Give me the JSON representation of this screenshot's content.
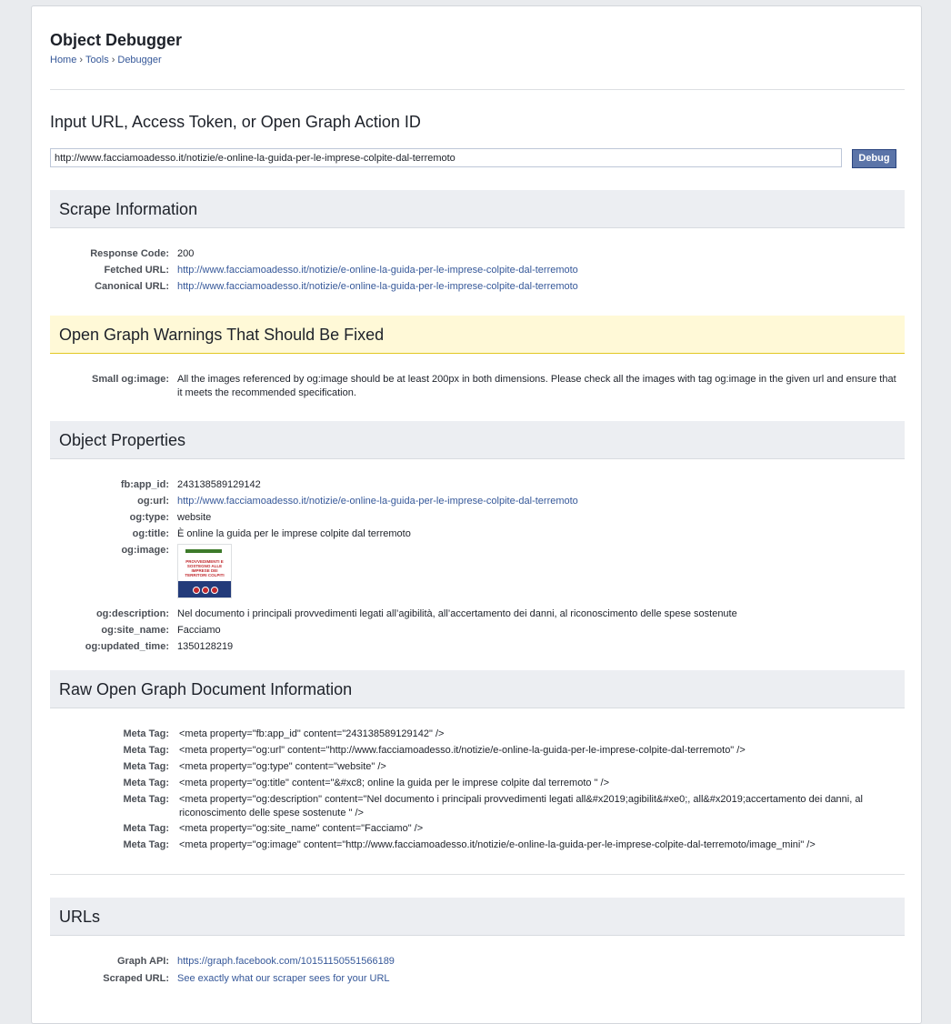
{
  "header": {
    "title": "Object Debugger",
    "breadcrumb": [
      "Home",
      "Tools",
      "Debugger"
    ],
    "breadcrumb_sep": "›"
  },
  "input": {
    "label": "Input URL, Access Token, or Open Graph Action ID",
    "value": "http://www.facciamoadesso.it/notizie/e-online-la-guida-per-le-imprese-colpite-dal-terremoto",
    "button": "Debug"
  },
  "scrape": {
    "title": "Scrape Information",
    "rows": [
      {
        "key": "Response Code:",
        "value": "200"
      },
      {
        "key": "Fetched URL:",
        "value": "http://www.facciamoadesso.it/notizie/e-online-la-guida-per-le-imprese-colpite-dal-terremoto"
      },
      {
        "key": "Canonical URL:",
        "value": "http://www.facciamoadesso.it/notizie/e-online-la-guida-per-le-imprese-colpite-dal-terremoto"
      }
    ]
  },
  "warnings": {
    "title": "Open Graph Warnings That Should Be Fixed",
    "rows": [
      {
        "key": "Small og:image:",
        "value": "All the images referenced by og:image should be at least 200px in both dimensions. Please check all the images with tag og:image in the given url and ensure that it meets the recommended specification."
      }
    ]
  },
  "properties": {
    "title": "Object Properties",
    "rows": [
      {
        "key": "fb:app_id:",
        "value": "243138589129142"
      },
      {
        "key": "og:url:",
        "value": "http://www.facciamoadesso.it/notizie/e-online-la-guida-per-le-imprese-colpite-dal-terremoto"
      },
      {
        "key": "og:type:",
        "value": "website"
      },
      {
        "key": "og:title:",
        "value": "È online la guida per le imprese colpite dal terremoto"
      },
      {
        "key": "og:image:",
        "value": ""
      },
      {
        "key": "og:description:",
        "value": "Nel documento i principali provvedimenti legati all’agibilità, all’accertamento dei danni, al riconoscimento delle spese sostenute"
      },
      {
        "key": "og:site_name:",
        "value": "Facciamo"
      },
      {
        "key": "og:updated_time:",
        "value": "1350128219"
      }
    ],
    "thumb_text": "PROVVEDIMENTI E SOSTEGNO ALLE IMPRESE DEI TERRITORI COLPITI"
  },
  "raw": {
    "title": "Raw Open Graph Document Information",
    "rows": [
      {
        "key": "Meta Tag:",
        "value": "<meta property=\"fb:app_id\" content=\"243138589129142\" />"
      },
      {
        "key": "Meta Tag:",
        "value": "<meta property=\"og:url\" content=\"http://www.facciamoadesso.it/notizie/e-online-la-guida-per-le-imprese-colpite-dal-terremoto\" />"
      },
      {
        "key": "Meta Tag:",
        "value": "<meta property=\"og:type\" content=\"website\" />"
      },
      {
        "key": "Meta Tag:",
        "value": "<meta property=\"og:title\" content=\"&#xc8; online la guida per le imprese colpite dal terremoto \" />"
      },
      {
        "key": "Meta Tag:",
        "value": "<meta property=\"og:description\" content=\"Nel documento i principali provvedimenti legati all&#x2019;agibilit&#xe0;, all&#x2019;accertamento dei danni, al riconoscimento delle spese sostenute \" />"
      },
      {
        "key": "Meta Tag:",
        "value": "<meta property=\"og:site_name\" content=\"Facciamo\" />"
      },
      {
        "key": "Meta Tag:",
        "value": "<meta property=\"og:image\" content=\"http://www.facciamoadesso.it/notizie/e-online-la-guida-per-le-imprese-colpite-dal-terremoto/image_mini\" />"
      }
    ]
  },
  "urls": {
    "title": "URLs",
    "rows": [
      {
        "key": "Graph API:",
        "value": "https://graph.facebook.com/10151150551566189"
      },
      {
        "key": "Scraped URL:",
        "value": "See exactly what our scraper sees for your URL"
      }
    ]
  },
  "colors": {
    "link": "#365899",
    "button": "#5b74a8",
    "section_bg": "#eceef2",
    "warning_bg": "#fff9d7"
  }
}
